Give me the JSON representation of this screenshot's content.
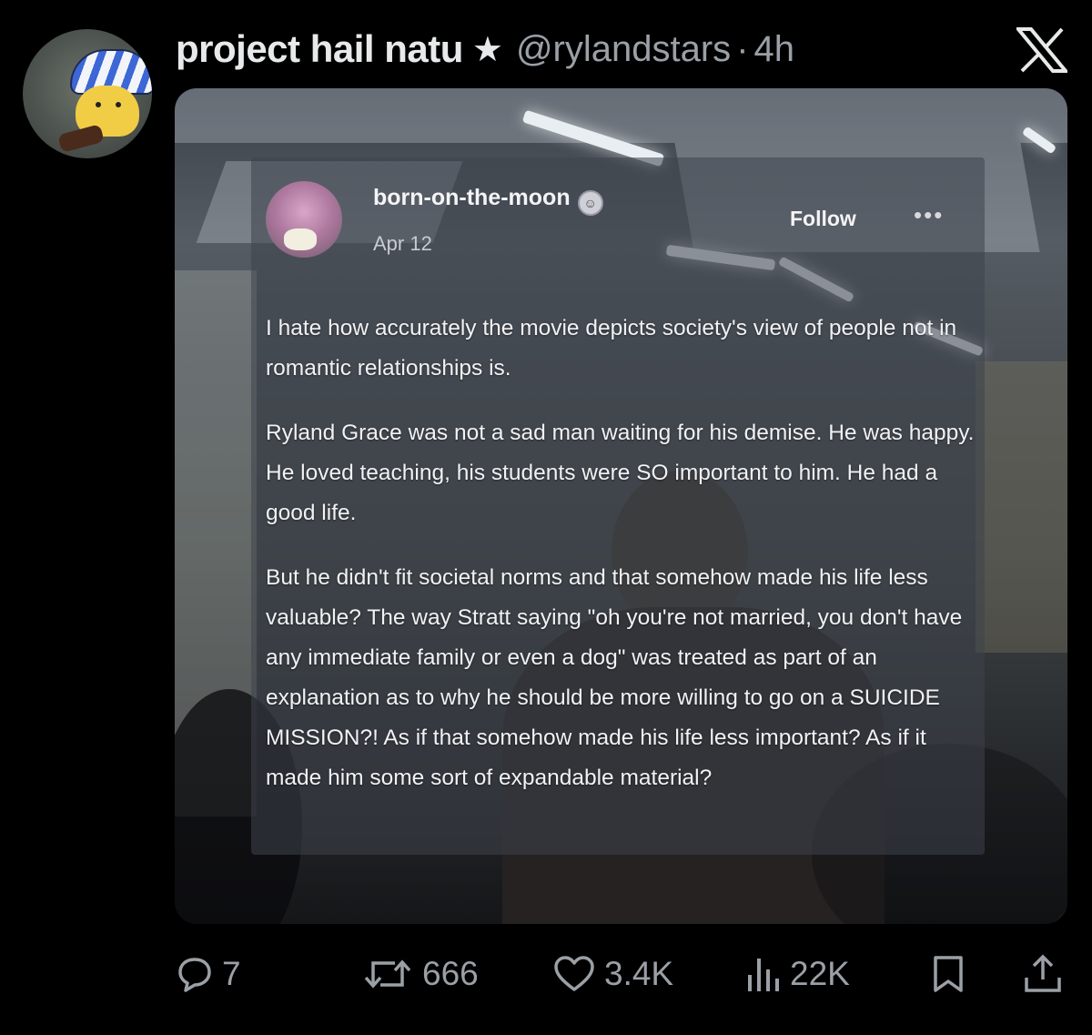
{
  "tweet": {
    "display_name": "project hail natu",
    "name_emoji": "★",
    "handle": "@rylandstars",
    "separator": "·",
    "timestamp": "4h"
  },
  "embedded_post": {
    "username": "born-on-the-moon",
    "badge_icon": "face-emoji-icon",
    "date": "Apr 12",
    "follow_label": "Follow",
    "more_label": "•••",
    "paragraphs": [
      "I hate how accurately  the movie depicts society's view of people not in romantic relationships is.",
      "Ryland Grace was not a sad man waiting for his demise. He was happy. He loved teaching, his students were SO important to him. He had a good life.",
      "But he didn't fit societal norms and that somehow made his life less valuable? The way Stratt saying \"oh you're not married, you don't have any immediate family or even a dog\" was treated as part of an explanation as to why he should be more willing to go on a SUICIDE MISSION?! As if that somehow made his life less important? As if it made him some sort of expandable material?"
    ]
  },
  "actions": {
    "replies": "7",
    "reposts": "666",
    "likes": "3.4K",
    "views": "22K"
  },
  "icons": {
    "logo": "x-logo-icon",
    "reply": "reply-icon",
    "repost": "repost-icon",
    "like": "heart-icon",
    "views": "views-chart-icon",
    "bookmark": "bookmark-icon",
    "share": "share-icon"
  },
  "colors": {
    "background": "#000000",
    "primary_text": "#e7e9ea",
    "secondary_text": "#9aa0a6"
  }
}
